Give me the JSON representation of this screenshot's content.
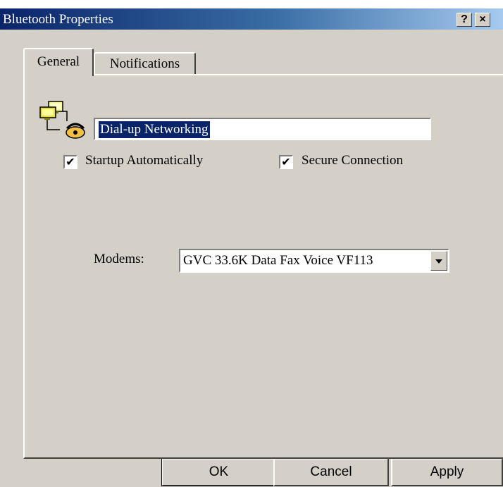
{
  "window": {
    "title": "Bluetooth Properties",
    "help_label": "?",
    "close_label": "×"
  },
  "tabs": [
    {
      "label": "General",
      "selected": true
    },
    {
      "label": "Notifications",
      "selected": false
    }
  ],
  "general": {
    "name_value": "Dial-up Networking",
    "startup_automatically": {
      "label": "Startup Automatically",
      "checked": true,
      "mark": "✔"
    },
    "secure_connection": {
      "label": "Secure Connection",
      "checked": true,
      "mark": "✔"
    },
    "modems": {
      "label": "Modems:",
      "selected": "GVC 33.6K Data Fax Voice VF113"
    }
  },
  "buttons": {
    "ok": "OK",
    "cancel": "Cancel",
    "apply": "Apply"
  },
  "icons": {
    "connection": "dialup-networking-icon",
    "dropdown": "chevron-down-icon"
  },
  "colors": {
    "face": "#d4d0c8",
    "title_start": "#0a246a",
    "title_end": "#a6caf0",
    "selection": "#0a246a"
  }
}
